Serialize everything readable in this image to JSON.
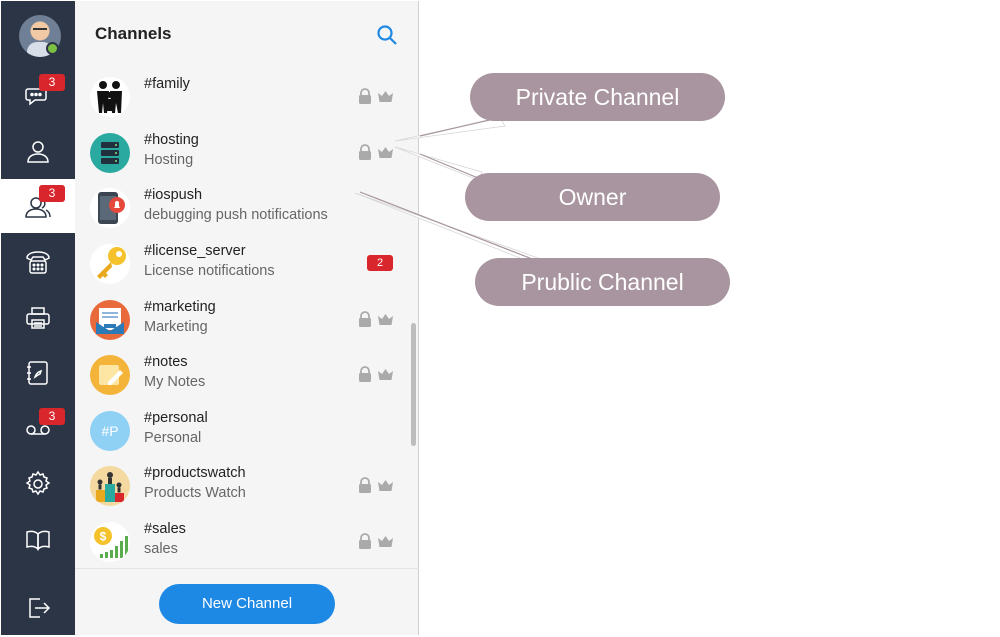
{
  "nav": {
    "items": [
      {
        "name": "chat",
        "badge": "3"
      },
      {
        "name": "contacts",
        "badge": ""
      },
      {
        "name": "channels",
        "badge": "3"
      },
      {
        "name": "phone",
        "badge": ""
      },
      {
        "name": "fax",
        "badge": ""
      },
      {
        "name": "address-book",
        "badge": ""
      },
      {
        "name": "voicemail",
        "badge": "3"
      },
      {
        "name": "settings",
        "badge": ""
      },
      {
        "name": "help",
        "badge": ""
      },
      {
        "name": "logout",
        "badge": ""
      }
    ]
  },
  "panel": {
    "title": "Channels",
    "new_channel_label": "New Channel"
  },
  "channels": [
    {
      "name": "#family",
      "description": "",
      "private": true,
      "owner": true,
      "badge": ""
    },
    {
      "name": "#hosting",
      "description": "Hosting",
      "private": true,
      "owner": true,
      "badge": ""
    },
    {
      "name": "#iospush",
      "description": "debugging push notifications",
      "private": false,
      "owner": false,
      "badge": ""
    },
    {
      "name": "#license_server",
      "description": "License notifications",
      "private": false,
      "owner": false,
      "badge": "2"
    },
    {
      "name": "#marketing",
      "description": "Marketing",
      "private": true,
      "owner": true,
      "badge": ""
    },
    {
      "name": "#notes",
      "description": "My Notes",
      "private": true,
      "owner": true,
      "badge": ""
    },
    {
      "name": "#personal",
      "description": "Personal",
      "private": false,
      "owner": false,
      "badge": "",
      "initials": "#P"
    },
    {
      "name": "#productswatch",
      "description": "Products Watch",
      "private": true,
      "owner": true,
      "badge": ""
    },
    {
      "name": "#sales",
      "description": "sales",
      "private": true,
      "owner": true,
      "badge": ""
    }
  ],
  "callouts": {
    "private": "Private Channel",
    "owner": "Owner",
    "public": "Prublic Channel"
  },
  "colors": {
    "rail": "#2b3546",
    "accent": "#1e88e5",
    "badge": "#d9262c",
    "callout": "#a8959f",
    "presence": "#7bc043"
  }
}
